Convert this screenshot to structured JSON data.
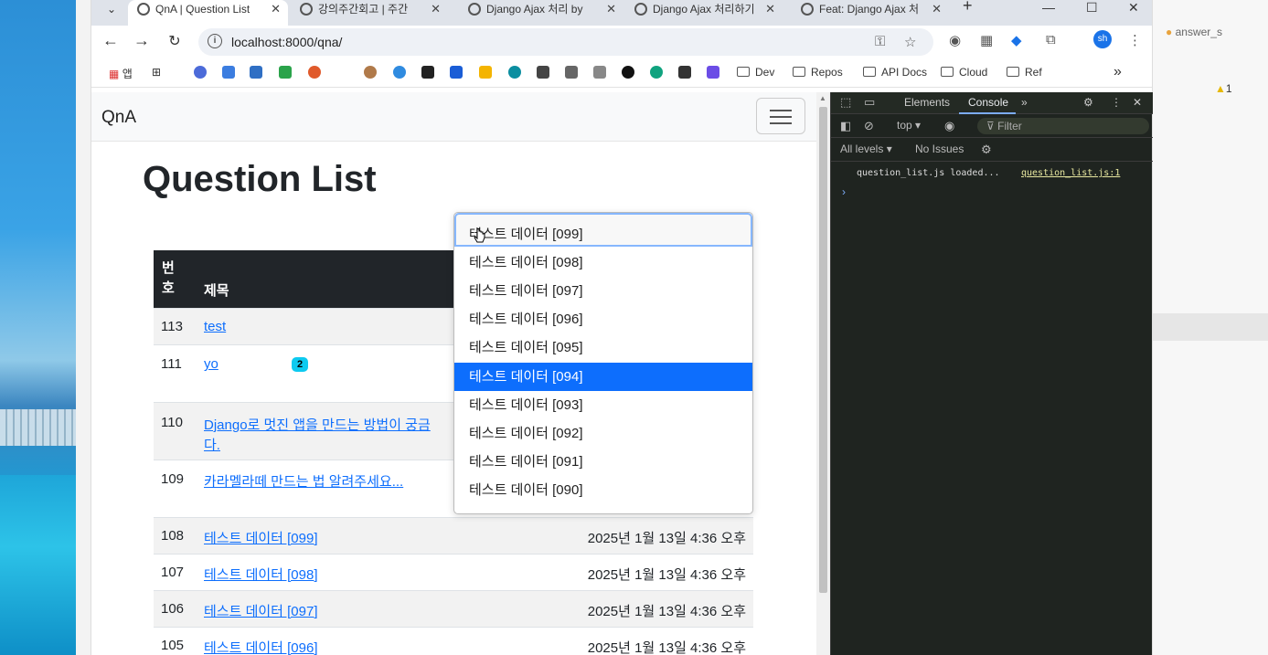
{
  "browser": {
    "tabs": [
      {
        "label": "QnA | Question List",
        "active": true
      },
      {
        "label": "강의주간회고 | 주간"
      },
      {
        "label": "Django Ajax 처리 by"
      },
      {
        "label": "Django Ajax 처리하기"
      },
      {
        "label": "Feat: Django Ajax 처"
      }
    ],
    "url": "localhost:8000/qna/",
    "avatar": "sh",
    "bookmarks": {
      "apps_label": "앱",
      "folders": [
        "Dev",
        "Repos",
        "API Docs",
        "Cloud",
        "Ref"
      ]
    }
  },
  "page": {
    "brand": "QnA",
    "title": "Question List",
    "table": {
      "headers": {
        "number": "번호",
        "subject": "제목"
      },
      "rows": [
        {
          "num": "113",
          "subject": "test",
          "badge": "",
          "date": ""
        },
        {
          "num": "111",
          "subject": "yo",
          "badge": "2",
          "date": ""
        },
        {
          "num": "110",
          "subject": "Django로 멋진 앱을 만드는 방법이 궁금",
          "subject2": "다.",
          "badge": "",
          "date": ""
        },
        {
          "num": "109",
          "subject": "카라멜라떼 만드는 법 알려주세요...",
          "badge": "",
          "date": ""
        },
        {
          "num": "108",
          "subject": "테스트 데이터 [099]",
          "badge": "",
          "date": "2025년 1월 13일 4:36 오후"
        },
        {
          "num": "107",
          "subject": "테스트 데이터 [098]",
          "badge": "",
          "date": "2025년 1월 13일 4:36 오후"
        },
        {
          "num": "106",
          "subject": "테스트 데이터 [097]",
          "badge": "",
          "date": "2025년 1월 13일 4:36 오후"
        },
        {
          "num": "105",
          "subject": "테스트 데이터 [096]",
          "badge": "",
          "date": "2025년 1월 13일 4:36 오후"
        }
      ]
    },
    "dropdown": {
      "options": [
        "테스트 데이터 [099]",
        "테스트 데이터 [098]",
        "테스트 데이터 [097]",
        "테스트 데이터 [096]",
        "테스트 데이터 [095]",
        "테스트 데이터 [094]",
        "테스트 데이터 [093]",
        "테스트 데이터 [092]",
        "테스트 데이터 [091]",
        "테스트 데이터 [090]"
      ],
      "highlighted": "테스트 데이터 [094]"
    }
  },
  "devtools": {
    "tabs": [
      "Elements",
      "Console"
    ],
    "active_tab": "Console",
    "context": "top",
    "filter_placeholder": "Filter",
    "levels": "All levels",
    "issues": "No Issues",
    "log_message": "question_list.js loaded...",
    "log_source": "question_list.js:1"
  },
  "background_app": {
    "file_label": "answer_s",
    "warning_count": "1"
  },
  "colors": {
    "primary": "#0d6efd",
    "dark_header": "#212529",
    "badge": "#0dcaf0"
  }
}
